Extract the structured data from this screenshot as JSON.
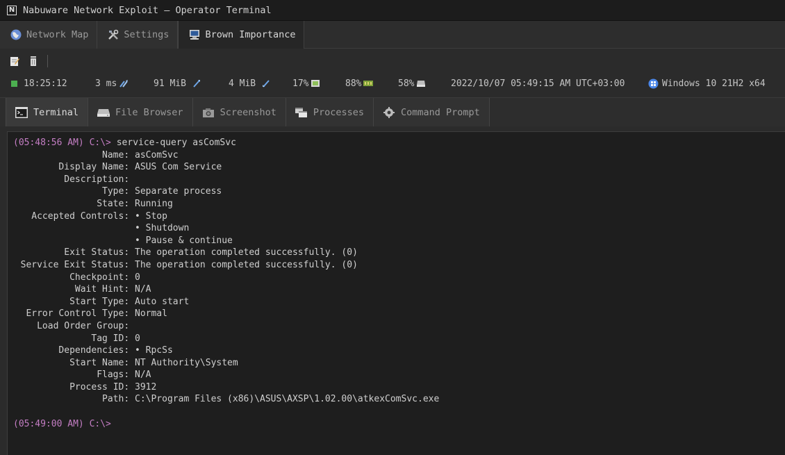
{
  "window": {
    "title": "Nabuware Network Exploit — Operator Terminal",
    "app_icon": "N"
  },
  "top_tabs": [
    {
      "label": "Network Map",
      "icon": "globe-icon",
      "active": false
    },
    {
      "label": "Settings",
      "icon": "tools-icon",
      "active": false
    },
    {
      "label": "Brown Importance",
      "icon": "computer-icon",
      "active": true
    }
  ],
  "toolbar": {
    "icons": [
      "notepad-icon",
      "trash-icon"
    ]
  },
  "status": {
    "online_color": "#4caf50",
    "time": "18:25:12",
    "latency": "3 ms",
    "mem_a": "91 MiB",
    "mem_b": "4 MiB",
    "cpu": "17%",
    "gpu": "88%",
    "disk": "58%",
    "datetime": "2022/10/07 05:49:15 AM UTC+03:00",
    "os": "Windows 10 21H2 x64"
  },
  "sub_tabs": [
    {
      "label": "Terminal",
      "icon": "terminal-icon",
      "active": true
    },
    {
      "label": "File Browser",
      "icon": "drive-icon",
      "active": false
    },
    {
      "label": "Screenshot",
      "icon": "camera-icon",
      "active": false
    },
    {
      "label": "Processes",
      "icon": "windows-stack-icon",
      "active": false
    },
    {
      "label": "Command Prompt",
      "icon": "gear-icon",
      "active": false
    }
  ],
  "terminal": {
    "prompt1": "(05:48:56 AM) C:\\> ",
    "command1": "service-query asComSvc",
    "rows": [
      {
        "k": "Name:",
        "v": "asComSvc"
      },
      {
        "k": "Display Name:",
        "v": "ASUS Com Service"
      },
      {
        "k": "Description:",
        "v": ""
      },
      {
        "k": "Type:",
        "v": "Separate process"
      },
      {
        "k": "State:",
        "v": "Running"
      },
      {
        "k": "Accepted Controls:",
        "v": "• Stop"
      },
      {
        "k": "",
        "v": "• Shutdown"
      },
      {
        "k": "",
        "v": "• Pause & continue"
      },
      {
        "k": "Exit Status:",
        "v": "The operation completed successfully. (0)"
      },
      {
        "k": "Service Exit Status:",
        "v": "The operation completed successfully. (0)"
      },
      {
        "k": "Checkpoint:",
        "v": "0"
      },
      {
        "k": "Wait Hint:",
        "v": "N/A"
      },
      {
        "k": "Start Type:",
        "v": "Auto start"
      },
      {
        "k": "Error Control Type:",
        "v": "Normal"
      },
      {
        "k": "Load Order Group:",
        "v": ""
      },
      {
        "k": "Tag ID:",
        "v": "0"
      },
      {
        "k": "Dependencies:",
        "v": "• RpcSs"
      },
      {
        "k": "Start Name:",
        "v": "NT Authority\\System"
      },
      {
        "k": "Flags:",
        "v": "N/A"
      },
      {
        "k": "Process ID:",
        "v": "3912"
      },
      {
        "k": "Path:",
        "v": "C:\\Program Files (x86)\\ASUS\\AXSP\\1.02.00\\atkexComSvc.exe"
      }
    ],
    "prompt2": "(05:49:00 AM) C:\\>"
  }
}
